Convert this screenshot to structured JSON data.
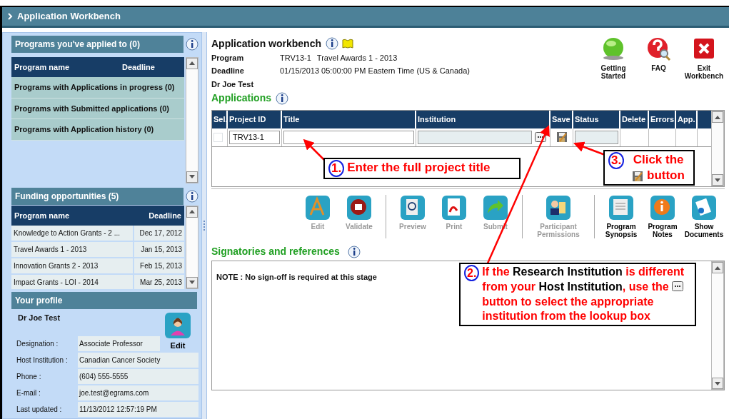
{
  "window": {
    "title": "Application Workbench"
  },
  "applied": {
    "title": "Programs you've applied to (0)",
    "columns": [
      "Program name",
      "Deadline"
    ],
    "rows": [
      "Programs with Applications in progress (0)",
      "Programs with Submitted applications (0)",
      "Programs with Application history (0)"
    ]
  },
  "funding": {
    "title": "Funding opportunities (5)",
    "columns": [
      "Program name",
      "Deadline"
    ],
    "rows": [
      {
        "name": "Knowledge to Action Grants - 2 ...",
        "deadline": "Dec 17, 2012"
      },
      {
        "name": "Travel Awards 1 - 2013",
        "deadline": "Jan 15, 2013"
      },
      {
        "name": "Innovation Grants 2 - 2013",
        "deadline": "Feb 15, 2013"
      },
      {
        "name": "Impact Grants - LOI - 2014",
        "deadline": "Mar 25, 2013"
      }
    ]
  },
  "profile": {
    "title": "Your profile",
    "name": "Dr Joe Test",
    "edit": "Edit",
    "fields": [
      {
        "label": "Designation :",
        "value": "Associate Professor"
      },
      {
        "label": "Host Institution :",
        "value": "Canadian Cancer Society"
      },
      {
        "label": "Phone :",
        "value": "(604) 555-5555"
      },
      {
        "label": "E-mail :",
        "value": "joe.test@egrams.com"
      },
      {
        "label": "Last updated :",
        "value": "11/13/2012 12:57:19 PM"
      }
    ]
  },
  "workbench": {
    "title": "Application workbench",
    "program_label": "Program",
    "program_id": "TRV13-1",
    "program_name": "Travel Awards 1 - 2013",
    "deadline_label": "Deadline",
    "deadline": "01/15/2013 05:00:00 PM Eastern Time (US & Canada)",
    "applicant": "Dr Joe Test"
  },
  "top_actions": [
    {
      "kind": "start",
      "label": "Getting Started"
    },
    {
      "kind": "faq",
      "label": "FAQ"
    },
    {
      "kind": "exit",
      "label": "Exit Workbench"
    }
  ],
  "applications": {
    "title": "Applications",
    "columns": [
      "Sel.",
      "Project ID",
      "Title",
      "Institution",
      "Save",
      "Status",
      "Delete",
      "Errors",
      "App."
    ],
    "rows": [
      {
        "checked": false,
        "project_id": "TRV13-1"
      }
    ]
  },
  "toolbar": [
    [
      {
        "kind": "edit",
        "label": "Edit",
        "disabled": true
      },
      {
        "kind": "validate",
        "label": "Validate",
        "disabled": true
      }
    ],
    [
      {
        "kind": "preview",
        "label": "Preview",
        "disabled": true
      },
      {
        "kind": "print",
        "label": "Print",
        "disabled": true
      },
      {
        "kind": "submit",
        "label": "Submit",
        "disabled": true
      }
    ],
    [
      {
        "kind": "permissions",
        "label": "Participant Permissions",
        "disabled": true
      }
    ],
    [
      {
        "kind": "synopsis",
        "label": "Program Synopsis",
        "disabled": false
      },
      {
        "kind": "notes",
        "label": "Program Notes",
        "disabled": false
      },
      {
        "kind": "documents",
        "label": "Show Documents",
        "disabled": false
      }
    ]
  ],
  "signatories": {
    "title": "Signatories and references",
    "note": "NOTE : No sign-off is required at this stage"
  },
  "callouts": [
    {
      "number": "1.",
      "parts": [
        {
          "kind": "text",
          "text": "Enter the full project title",
          "highlight": false
        }
      ]
    },
    {
      "number": "3.",
      "parts": [
        {
          "kind": "text",
          "text": "Click the ",
          "highlight": false
        },
        {
          "kind": "save-icon"
        },
        {
          "kind": "text",
          "text": " button",
          "highlight": false
        }
      ]
    },
    {
      "number": "2.",
      "parts": [
        {
          "kind": "text",
          "text": "If the ",
          "highlight": false
        },
        {
          "kind": "text",
          "text": "Research Institution",
          "highlight": true
        },
        {
          "kind": "text",
          "text": " is different from your ",
          "highlight": false
        },
        {
          "kind": "text",
          "text": "Host Institution",
          "highlight": true
        },
        {
          "kind": "text",
          "text": ", use the ",
          "highlight": false
        },
        {
          "kind": "lookup-icon"
        },
        {
          "kind": "text",
          "text": "button to select the appropriate institution from the lookup box",
          "highlight": false
        }
      ]
    }
  ]
}
